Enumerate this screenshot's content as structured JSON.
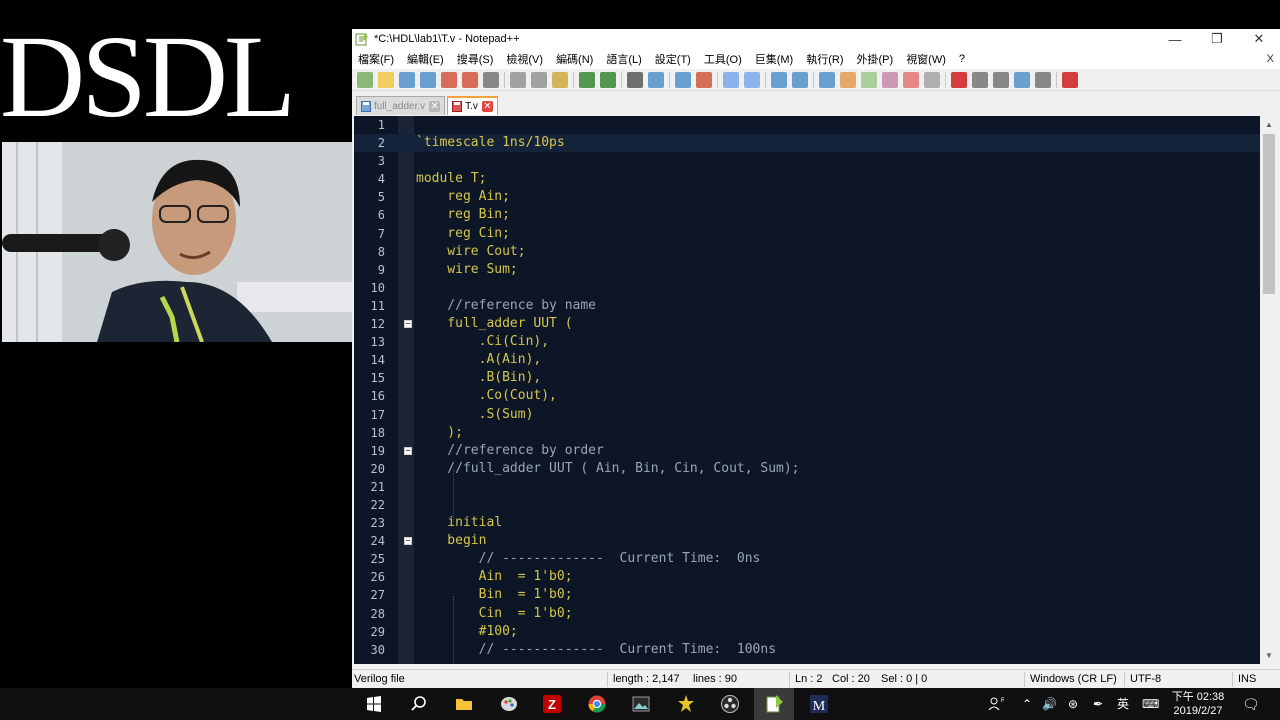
{
  "overlay": {
    "brand_text": "DSDL"
  },
  "window": {
    "title": "*C:\\HDL\\lab1\\T.v - Notepad++",
    "controls": [
      "minimize",
      "restore",
      "close"
    ]
  },
  "menu": [
    "檔案(F)",
    "編輯(E)",
    "搜尋(S)",
    "檢視(V)",
    "編碼(N)",
    "語言(L)",
    "設定(T)",
    "工具(O)",
    "巨集(M)",
    "執行(R)",
    "外掛(P)",
    "視窗(W)",
    "?"
  ],
  "menu_close": "X",
  "tabs": [
    {
      "label": "full_adder.v",
      "active": false
    },
    {
      "label": "T.v",
      "active": true
    }
  ],
  "editor": {
    "lines": [
      {
        "n": "1",
        "text": ""
      },
      {
        "n": "2",
        "text": "`timescale 1ns/10ps"
      },
      {
        "n": "3",
        "text": ""
      },
      {
        "n": "4",
        "text": "module T;"
      },
      {
        "n": "5",
        "text": "    reg Ain;"
      },
      {
        "n": "6",
        "text": "    reg Bin;"
      },
      {
        "n": "7",
        "text": "    reg Cin;"
      },
      {
        "n": "8",
        "text": "    wire Cout;"
      },
      {
        "n": "9",
        "text": "    wire Sum;"
      },
      {
        "n": "10",
        "text": ""
      },
      {
        "n": "11",
        "text": "    //reference by name"
      },
      {
        "n": "12",
        "text": "    full_adder UUT ("
      },
      {
        "n": "13",
        "text": "        .Ci(Cin),"
      },
      {
        "n": "14",
        "text": "        .A(Ain),"
      },
      {
        "n": "15",
        "text": "        .B(Bin),"
      },
      {
        "n": "16",
        "text": "        .Co(Cout),"
      },
      {
        "n": "17",
        "text": "        .S(Sum)"
      },
      {
        "n": "18",
        "text": "    );"
      },
      {
        "n": "19",
        "text": "    //reference by order"
      },
      {
        "n": "20",
        "text": "    //full_adder UUT ( Ain, Bin, Cin, Cout, Sum);"
      },
      {
        "n": "21",
        "text": ""
      },
      {
        "n": "22",
        "text": ""
      },
      {
        "n": "23",
        "text": "    initial"
      },
      {
        "n": "24",
        "text": "    begin"
      },
      {
        "n": "25",
        "text": "        // -------------  Current Time:  0ns"
      },
      {
        "n": "26",
        "text": "        Ain  = 1'b0;"
      },
      {
        "n": "27",
        "text": "        Bin  = 1'b0;"
      },
      {
        "n": "28",
        "text": "        Cin  = 1'b0;"
      },
      {
        "n": "29",
        "text": "        #100;"
      },
      {
        "n": "30",
        "text": "        // -------------  Current Time:  100ns"
      }
    ],
    "current_line": 2,
    "fold_lines": [
      12,
      19,
      24
    ]
  },
  "status": {
    "language": "Verilog file",
    "length": "length : 2,147",
    "lines": "lines : 90",
    "ln": "Ln : 2",
    "col": "Col : 20",
    "sel": "Sel : 0 | 0",
    "eol": "Windows (CR LF)",
    "encoding": "UTF-8",
    "mode": "INS"
  },
  "taskbar": {
    "ime": "英",
    "time": "下午 02:38",
    "date": "2019/2/27"
  },
  "colors": {
    "editor_bg": "#0c1626",
    "code_text": "#d6c64a",
    "comment_text": "#9aa6b2",
    "tab_accent": "#f7a13b"
  }
}
